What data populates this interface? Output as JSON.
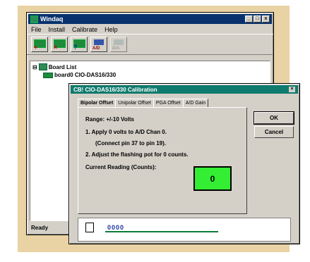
{
  "window": {
    "title": "Windaq",
    "buttons": [
      "_",
      "□",
      "x"
    ]
  },
  "menu": [
    "File",
    "Install",
    "Calibrate",
    "Help"
  ],
  "toolbar": {
    "tools": [
      {
        "name": "install-board",
        "mark": "+",
        "color": "#d00000"
      },
      {
        "name": "remove-board",
        "mark": "×",
        "color": "#d00000"
      },
      {
        "name": "test-board",
        "mark": "?",
        "color": "#003399"
      },
      {
        "name": "ad-tool",
        "text": "A/D"
      },
      {
        "name": "d2a-tool",
        "text": "D/A"
      }
    ]
  },
  "tree": {
    "root_label": "Board List",
    "board_label": "board0  CIO-DAS16/330"
  },
  "status": "Ready",
  "dialog": {
    "title": "CB! CIO-DAS16/330 Calibration",
    "tabs": [
      "Bipolar Offset",
      "Unipolar Offset",
      "PGA Offset",
      "A/D Gain"
    ],
    "active_tab": 0,
    "range": "Range: +/-10 Volts",
    "step1": "1. Apply 0 volts to A/D Chan 0.",
    "step1b": "(Connect pin 37 to pin 19).",
    "step2": "2. Adjust the flashing pot for 0 counts.",
    "reading_label": "Current Reading (Counts):",
    "reading_value": "0",
    "ok": "OK",
    "cancel": "Cancel",
    "slider_value": "0000"
  }
}
